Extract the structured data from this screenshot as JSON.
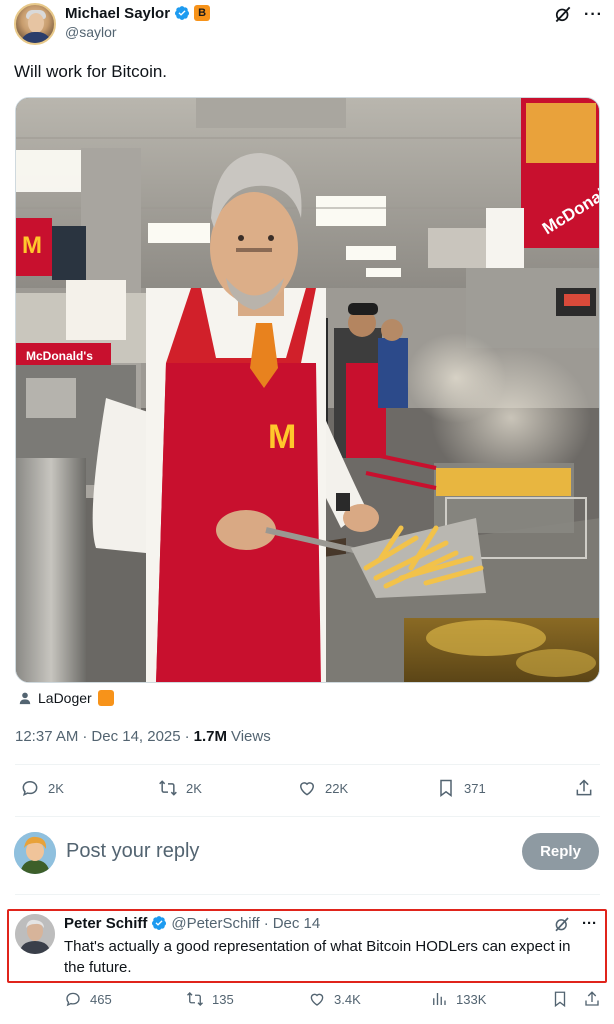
{
  "post": {
    "author_name": "Michael Saylor",
    "author_handle": "@saylor",
    "badge_letter": "B",
    "text": "Will work for Bitcoin.",
    "media_credit": "LaDoger",
    "time": "12:37 AM",
    "date": "Dec 14, 2025",
    "views_count": "1.7M",
    "views_label": "Views",
    "stats": {
      "replies": "2K",
      "reposts": "2K",
      "likes": "22K",
      "bookmarks": "371"
    }
  },
  "photo_sign_left": "McDonald's",
  "photo_sign_right": "McDonald's",
  "composer": {
    "placeholder": "Post your reply",
    "button_label": "Reply"
  },
  "reply": {
    "author_name": "Peter Schiff",
    "author_handle": "@PeterSchiff",
    "date": "Dec 14",
    "text": "That's actually a good representation of what Bitcoin HODLers can expect in the future.",
    "stats": {
      "replies": "465",
      "reposts": "135",
      "likes": "3.4K",
      "views": "133K"
    }
  },
  "colors": {
    "verified_blue": "#1d9bf0",
    "bitcoin_orange": "#f7931a",
    "highlight_red": "#e0241b",
    "mcdonalds_red": "#c8102e",
    "mcdonalds_yellow": "#ffc72c"
  }
}
